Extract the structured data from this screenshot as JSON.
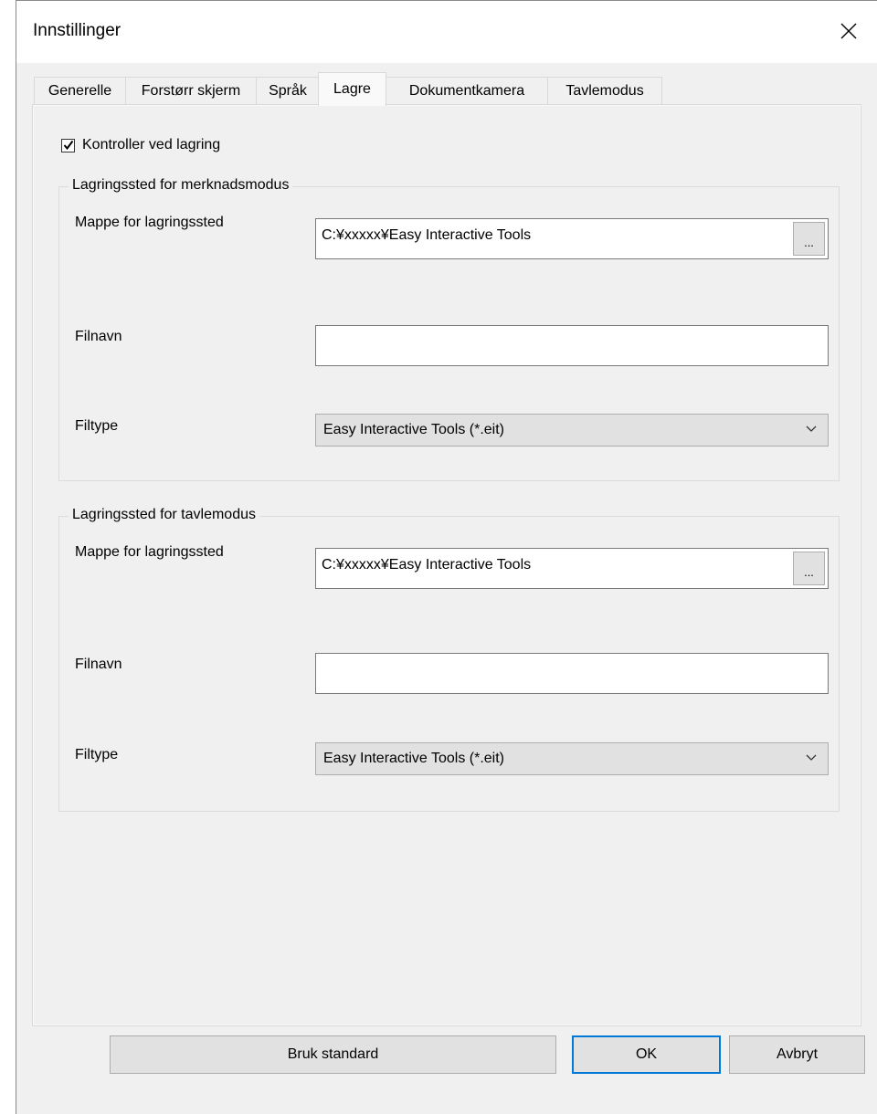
{
  "window": {
    "title": "Innstillinger"
  },
  "tabs": [
    {
      "label": "Generelle"
    },
    {
      "label": "Forstørr skjerm"
    },
    {
      "label": "Språk"
    },
    {
      "label": "Lagre"
    },
    {
      "label": "Dokumentkamera"
    },
    {
      "label": "Tavlemodus"
    }
  ],
  "active_tab": "Lagre",
  "verify_on_save": {
    "label": "Kontroller ved lagring",
    "checked": true
  },
  "annotation_group": {
    "title": "Lagringssted for merknadsmodus",
    "folder_label": "Mappe for lagringssted",
    "folder_value": "C:¥xxxxx¥Easy Interactive Tools",
    "browse_label": "...",
    "filename_label": "Filnavn",
    "filename_value": "",
    "filetype_label": "Filtype",
    "filetype_value": "Easy Interactive Tools (*.eit)"
  },
  "whiteboard_group": {
    "title": "Lagringssted for tavlemodus",
    "folder_label": "Mappe for lagringssted",
    "folder_value": "C:¥xxxxx¥Easy Interactive Tools",
    "browse_label": "...",
    "filename_label": "Filnavn",
    "filename_value": "",
    "filetype_label": "Filtype",
    "filetype_value": "Easy Interactive Tools (*.eit)"
  },
  "buttons": {
    "default_label": "Bruk standard",
    "ok_label": "OK",
    "cancel_label": "Avbryt"
  },
  "icons": {
    "close": "close-icon",
    "check": "checkmark-icon",
    "dropdown": "chevron-down-icon"
  },
  "colors": {
    "focus_border": "#0078d7",
    "button_face": "#e1e1e1",
    "window_bg": "#f0f0f0"
  }
}
